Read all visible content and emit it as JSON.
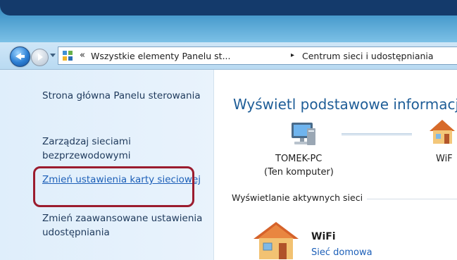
{
  "address_bar": {
    "prefix": "«",
    "crumb_1": "Wszystkie elementy Panelu st...",
    "separator": "▸",
    "crumb_2": "Centrum sieci i udostępniania"
  },
  "sidebar": {
    "items": [
      {
        "label": "Strona główna Panelu sterowania"
      },
      {
        "label": "Zarządzaj sieciami bezprzewodowymi"
      },
      {
        "label": "Zmień ustawienia karty sieciowej"
      },
      {
        "label": "Zmień zaawansowane ustawienia udostępniania"
      }
    ]
  },
  "main": {
    "title": "Wyświetl podstawowe informacj",
    "computer_name": "TOMEK-PC",
    "computer_sub": "(Ten komputer)",
    "network_label_top": "WiF",
    "section_label": "Wyświetlanie aktywnych sieci",
    "active_network": {
      "name": "WiFi",
      "type": "Sieć domowa"
    }
  },
  "icons": {
    "back": "back-arrow-icon",
    "forward": "forward-arrow-icon",
    "control_panel": "control-panel-icon",
    "computer": "computer-icon",
    "home_network": "house-icon"
  },
  "colors": {
    "link": "#1c5fb8",
    "title": "#1e5d97",
    "highlight": "#9b1c2e"
  }
}
